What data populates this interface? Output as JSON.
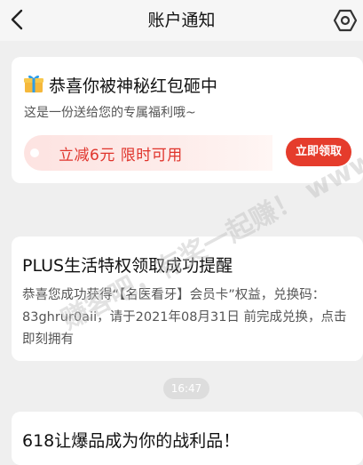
{
  "header": {
    "title": "账户通知"
  },
  "notifications": [
    {
      "title": "恭喜你被神秘红包砸中",
      "subtitle": "这是一份送给您的专属福利哦~",
      "coupon_text": "立减6元 限时可用",
      "action_label": "立即领取"
    },
    {
      "title": "PLUS生活特权领取成功提醒",
      "body": "恭喜您成功获得“【名医看牙】会员卡”权益，兑换码：83ghrur0aii，请于2021年08月31日 前完成兑换，点击即刻拥有"
    },
    {
      "time": "16:47",
      "title": "618让爆品成为你的战利品！"
    }
  ],
  "watermark": "赚客吧，有奖一起赚！ www.zuanke8.com",
  "colors": {
    "accent": "#e53c2c",
    "coupon_text": "#e0342c",
    "background": "#efefef"
  },
  "icons": {
    "back": "chevron-left-icon",
    "settings": "settings-icon",
    "gift": "gift-icon"
  }
}
